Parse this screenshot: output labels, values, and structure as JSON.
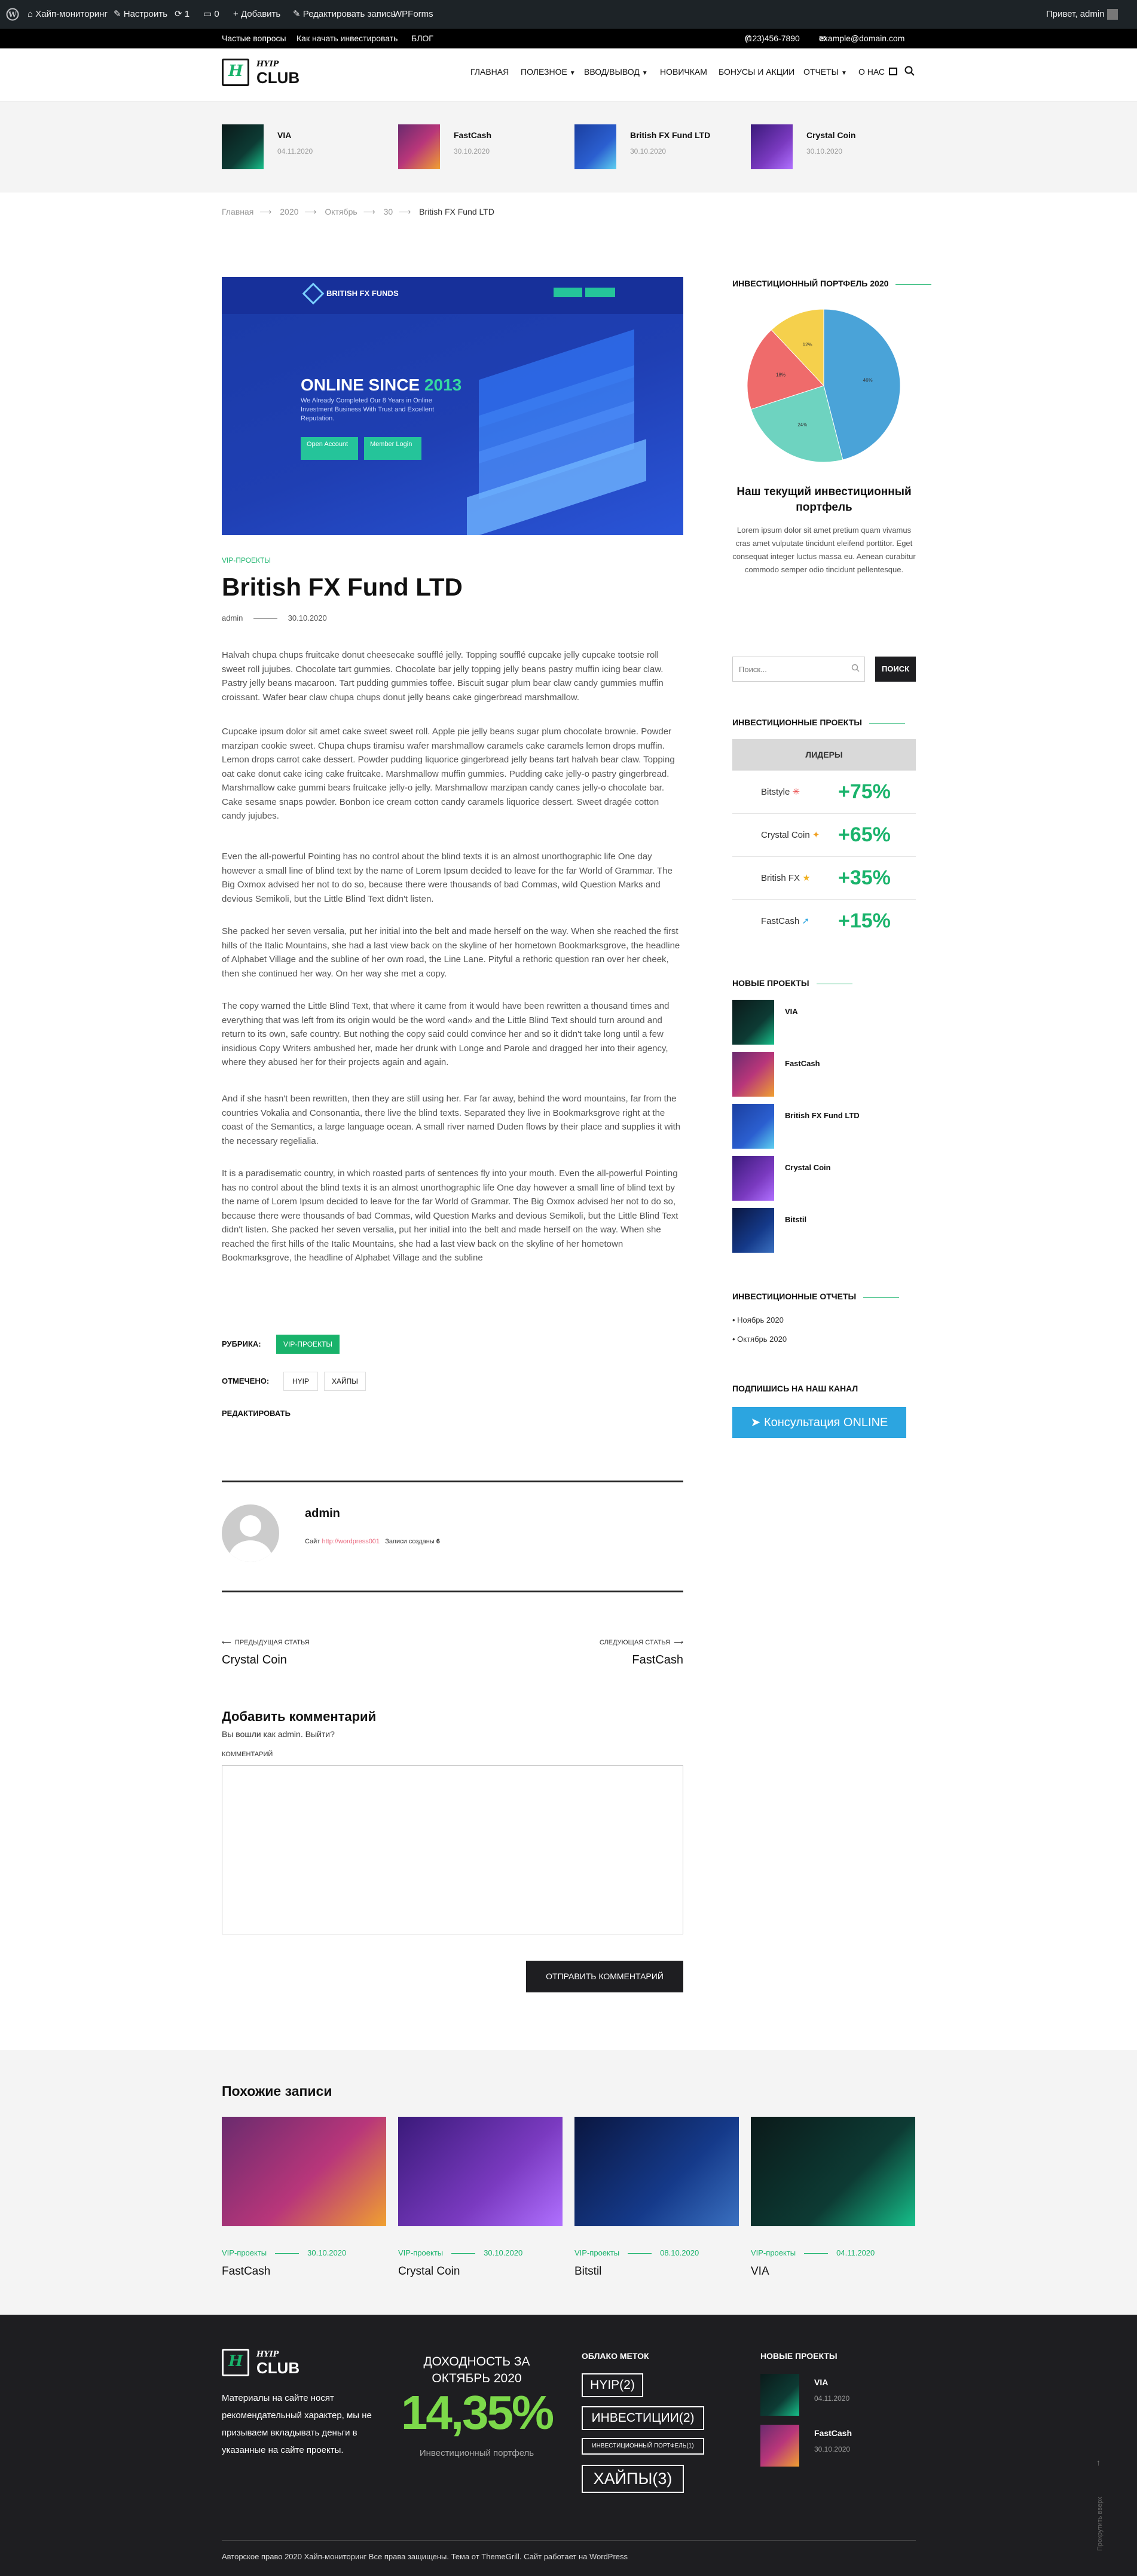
{
  "adminbar": {
    "site_name": "Хайп-мониторинг",
    "customize": "Настроить",
    "updates_count": "1",
    "comments_count": "0",
    "new_label": "Добавить",
    "edit_post": "Редактировать запись",
    "wpforms": "WPForms",
    "greeting": "Привет, admin"
  },
  "topbar": {
    "links": [
      "Частые вопросы",
      "Как начать инвестировать",
      "БЛОГ"
    ],
    "phone": "(123)456-7890",
    "email": "example@domain.com"
  },
  "logo": {
    "mark": "H",
    "script": "HYIP",
    "name": "CLUB"
  },
  "nav": [
    "ГЛАВНАЯ",
    "ПОЛЕЗНОЕ",
    "ВВОД/ВЫВОД",
    "НОВИЧКАМ",
    "БОНУСЫ И АКЦИИ",
    "ОТЧЕТЫ",
    "О НАС"
  ],
  "strip": [
    {
      "title": "VIA",
      "date": "04.11.2020"
    },
    {
      "title": "FastCash",
      "date": "30.10.2020"
    },
    {
      "title": "British FX Fund LTD",
      "date": "30.10.2020"
    },
    {
      "title": "Crystal Coin",
      "date": "30.10.2020"
    }
  ],
  "breadcrumb": [
    "Главная",
    "2020",
    "Октябрь",
    "30",
    "British FX Fund LTD"
  ],
  "hero": {
    "brand": "BRITISH FX FUNDS",
    "big": "ONLINE SINCE",
    "year": "2013",
    "sub": "We Already Completed Our 8 Years in Online Investment Business With Trust and Excellent Reputation.",
    "open": "Open Account",
    "login": "Member Login"
  },
  "post": {
    "category": "VIP-ПРОЕКТЫ",
    "title": "British FX Fund LTD",
    "author": "admin",
    "date": "30.10.2020",
    "paragraphs": [
      "Halvah chupa chups fruitcake donut cheesecake soufflé jelly. Topping soufflé cupcake jelly cupcake tootsie roll sweet roll jujubes. Chocolate tart gummies. Chocolate bar jelly topping jelly beans pastry muffin icing bear claw. Pastry jelly beans macaroon. Tart pudding gummies toffee. Biscuit sugar plum bear claw candy gummies muffin croissant. Wafer bear claw chupa chups donut jelly beans cake gingerbread marshmallow.",
      "Cupcake ipsum dolor sit amet cake sweet sweet roll. Apple pie jelly beans sugar plum chocolate brownie. Powder marzipan cookie sweet. Chupa chups tiramisu wafer marshmallow caramels cake caramels lemon drops muffin. Lemon drops carrot cake dessert. Powder pudding liquorice gingerbread jelly beans tart halvah bear claw. Topping oat cake donut cake icing cake fruitcake. Marshmallow muffin gummies. Pudding cake jelly-o pastry gingerbread. Marshmallow cake gummi bears fruitcake jelly-o jelly. Marshmallow marzipan candy canes jelly-o chocolate bar. Cake sesame snaps powder. Bonbon ice cream cotton candy caramels liquorice dessert. Sweet dragée cotton candy jujubes.",
      "Even the all-powerful Pointing has no control about the blind texts it is an almost unorthographic life One day however a small line of blind text by the name of Lorem Ipsum decided to leave for the far World of Grammar. The Big Oxmox advised her not to do so, because there were thousands of bad Commas, wild Question Marks and devious Semikoli, but the Little Blind Text didn't listen.",
      "She packed her seven versalia, put her initial into the belt and made herself on the way. When she reached the first hills of the Italic Mountains, she had a last view back on the skyline of her hometown Bookmarksgrove, the headline of Alphabet Village and the subline of her own road, the Line Lane. Pityful a rethoric question ran over her cheek, then she continued her way. On her way she met a copy.",
      "The copy warned the Little Blind Text, that where it came from it would have been rewritten a thousand times and everything that was left from its origin would be the word «and» and the Little Blind Text should turn around and return to its own, safe country. But nothing the copy said could convince her and so it didn't take long until a few insidious Copy Writers ambushed her, made her drunk with Longe and Parole and dragged her into their agency, where they abused her for their projects again and again.",
      "And if she hasn't been rewritten, then they are still using her. Far far away, behind the word mountains, far from the countries Vokalia and Consonantia, there live the blind texts. Separated they live in Bookmarksgrove right at the coast of the Semantics, a large language ocean. A small river named Duden flows by their place and supplies it with the necessary regelialia.",
      "It is a paradisematic country, in which roasted parts of sentences fly into your mouth. Even the all-powerful Pointing has no control about the blind texts it is an almost unorthographic life One day however a small line of blind text by the name of Lorem Ipsum decided to leave for the far World of Grammar. The Big Oxmox advised her not to do so, because there were thousands of bad Commas, wild Question Marks and devious Semikoli, but the Little Blind Text didn't listen. She packed her seven versalia, put her initial into the belt and made herself on the way. When she reached the first hills of the Italic Mountains, she had a last view back on the skyline of her hometown Bookmarksgrove, the headline of Alphabet Village and the subline"
    ],
    "rubric_label": "РУБРИКА:",
    "rubric_value": "VIP-ПРОЕКТЫ",
    "tags_label": "ОТМЕЧЕНО:",
    "tags": [
      "HYIP",
      "ХАЙПЫ"
    ],
    "edit_label": "РЕДАКТИРОВАТЬ"
  },
  "author_box": {
    "name": "admin",
    "site_label": "Сайт",
    "site_url": "http://wordpress001",
    "posts_label": "Записи созданы",
    "posts_count": "6"
  },
  "post_nav": {
    "prev_label": "ПРЕДЫДУЩАЯ СТАТЬЯ",
    "prev_title": "Crystal Coin",
    "next_label": "СЛЕДУЮЩАЯ СТАТЬЯ",
    "next_title": "FastCash"
  },
  "comment": {
    "title": "Добавить комментарий",
    "logged": "Вы вошли как admin. Выйти?",
    "label": "КОММЕНТАРИЙ",
    "submit": "ОТПРАВИТЬ КОММЕНТАРИЙ"
  },
  "sidebar": {
    "portfolio_title": "ИНВЕСТИЦИОННЫЙ ПОРТФЕЛЬ 2020",
    "portfolio_heading": "Наш текущий инвестиционный портфель",
    "portfolio_text": "Lorem ipsum dolor sit amet pretium quam vivamus cras amet vulputate tincidunt eleifend porttitor. Eget consequat integer luctus massa eu. Aenean curabitur commodo semper odio tincidunt pellentesque.",
    "search_placeholder": "Поиск...",
    "search_button": "ПОИСК",
    "projects_title": "ИНВЕСТИЦИОННЫЕ ПРОЕКТЫ",
    "leaders_label": "ЛИДЕРЫ",
    "leaders": [
      {
        "name": "Bitstyle",
        "value": "+75%"
      },
      {
        "name": "Crystal Coin",
        "value": "+65%"
      },
      {
        "name": "British FX",
        "value": "+35%"
      },
      {
        "name": "FastCash",
        "value": "+15%"
      }
    ],
    "new_title": "НОВЫЕ ПРОЕКТЫ",
    "new_projects": [
      "VIA",
      "FastCash",
      "British FX Fund LTD",
      "Crystal Coin",
      "Bitstil"
    ],
    "reports_title": "ИНВЕСТИЦИОННЫЕ ОТЧЕТЫ",
    "reports": [
      "Ноябрь 2020",
      "Октябрь 2020"
    ],
    "channel_title": "ПОДПИШИСЬ НА НАШ КАНАЛ",
    "channel_button": "Консультация ONLINE"
  },
  "chart_data": {
    "type": "pie",
    "slices": [
      {
        "label": "",
        "value": 46,
        "color": "#4aa3d8"
      },
      {
        "label": "",
        "value": 24,
        "color": "#6ed3c0"
      },
      {
        "label": "",
        "value": 18,
        "color": "#ef6b6b"
      },
      {
        "label": "",
        "value": 12,
        "color": "#f5d04c"
      }
    ],
    "labels": [
      "46%",
      "24%",
      "18%",
      "12%"
    ]
  },
  "related": {
    "title": "Похожие записи",
    "items": [
      {
        "category": "VIP-проекты",
        "date": "30.10.2020",
        "title": "FastCash"
      },
      {
        "category": "VIP-проекты",
        "date": "30.10.2020",
        "title": "Crystal Coin"
      },
      {
        "category": "VIP-проекты",
        "date": "08.10.2020",
        "title": "Bitstil"
      },
      {
        "category": "VIP-проекты",
        "date": "04.11.2020",
        "title": "VIA"
      }
    ]
  },
  "footer": {
    "disclaimer": "Материалы на сайте носят рекомендательный характер, мы не призываем вкладывать деньги в указанные на сайте проекты.",
    "yield_title": "ДОХОДНОСТЬ ЗА ОКТЯБРЬ 2020",
    "yield_value": "14,35%",
    "yield_sub": "Инвестиционный портфель",
    "tags_title": "ОБЛАКО МЕТОК",
    "tags": [
      "HYIP(2)",
      "ИНВЕСТИЦИИ(2)",
      "ИНВЕСТИЦИОННЫЙ ПОРТФЕЛЬ(1)",
      "ХАЙПЫ(3)"
    ],
    "new_title": "НОВЫЕ ПРОЕКТЫ",
    "new_items": [
      {
        "title": "VIA",
        "date": "04.11.2020"
      },
      {
        "title": "FastCash",
        "date": "30.10.2020"
      }
    ],
    "copyright": "Авторское право 2020 Хайп-мониторинг Все права защищены. Тема от ThemeGrill. Сайт работает на WordPress",
    "scroll": "Прокрутить вверх"
  },
  "colors": {
    "accent": "#19b36b",
    "dark": "#1e1e21",
    "adminbar": "#1d2327",
    "telegram": "#2ca5e0"
  }
}
